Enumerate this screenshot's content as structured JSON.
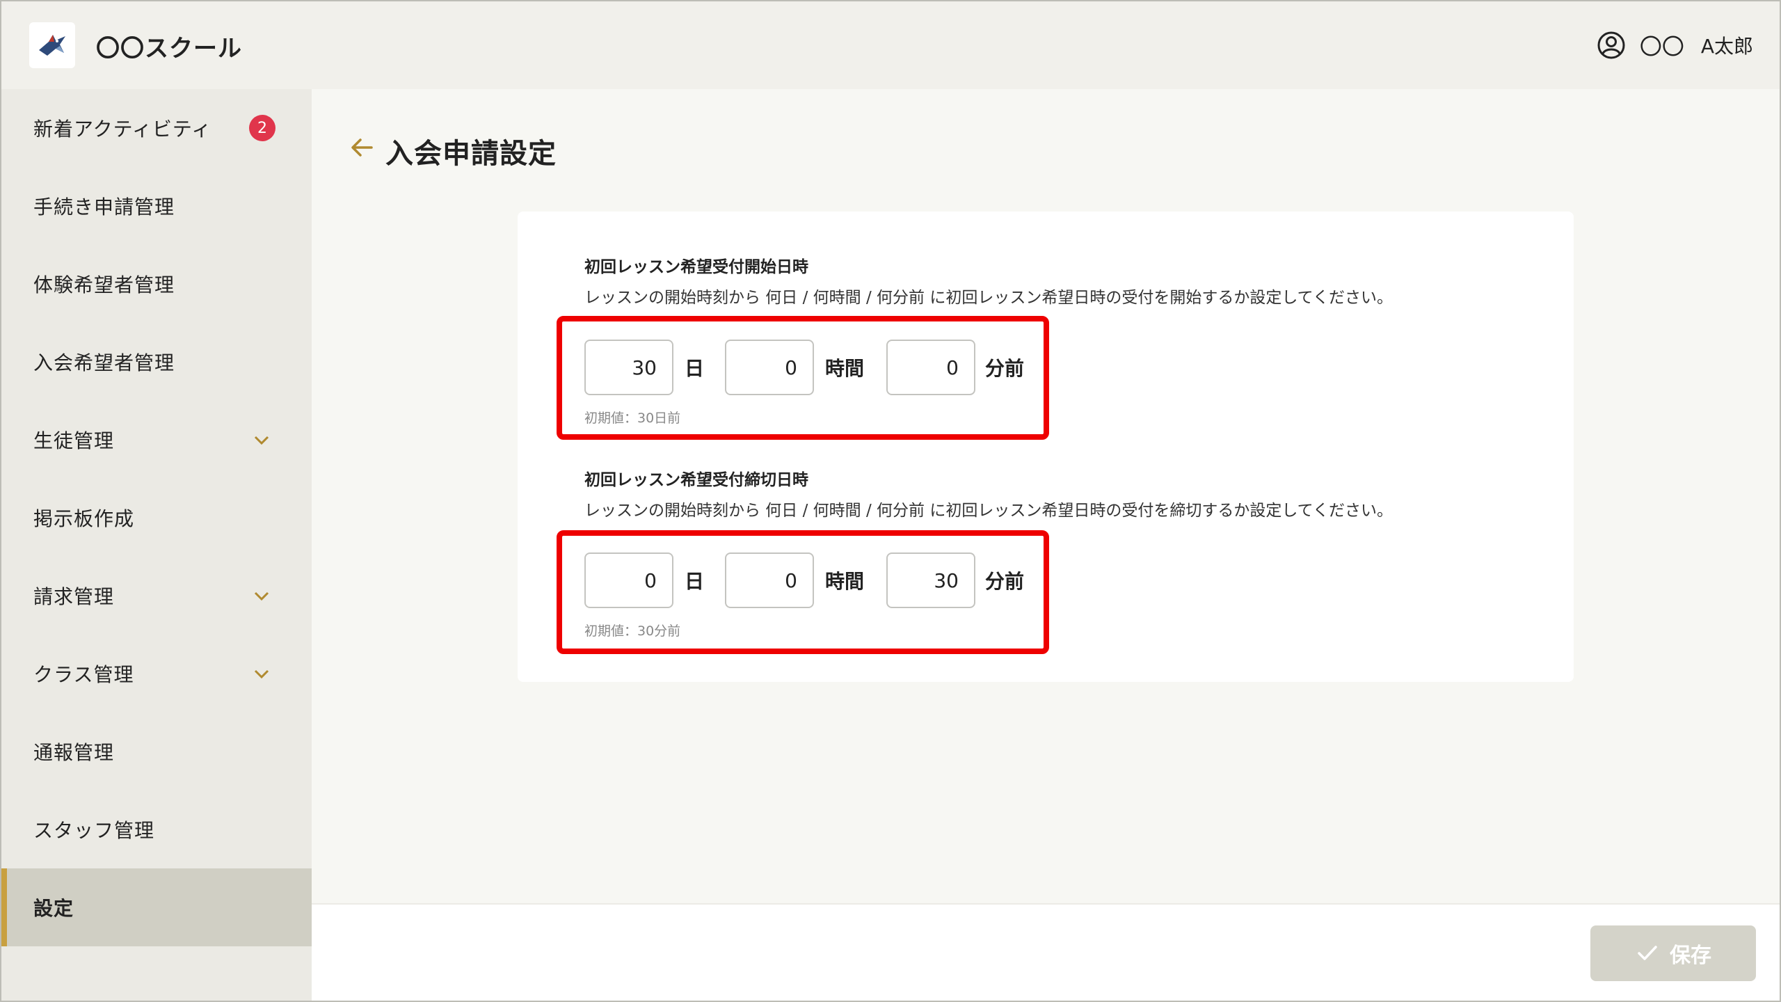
{
  "header": {
    "logo_icon": "bird-logo-icon",
    "school_name": "〇〇スクール",
    "user_icon": "user-circle-icon",
    "user_family": "〇〇",
    "user_given": "A太郎"
  },
  "sidebar": {
    "items": [
      {
        "label": "新着アクティビティ",
        "badge": "2"
      },
      {
        "label": "手続き申請管理"
      },
      {
        "label": "体験希望者管理"
      },
      {
        "label": "入会希望者管理"
      },
      {
        "label": "生徒管理",
        "expandable": true
      },
      {
        "label": "掲示板作成"
      },
      {
        "label": "請求管理",
        "expandable": true
      },
      {
        "label": "クラス管理",
        "expandable": true
      },
      {
        "label": "通報管理"
      },
      {
        "label": "スタッフ管理"
      },
      {
        "label": "設定",
        "active": true
      }
    ]
  },
  "page": {
    "title": "入会申請設定"
  },
  "sections": [
    {
      "title": "初回レッスン希望受付開始日時",
      "description": "レッスンの開始時刻から 何日 / 何時間 / 何分前 に初回レッスン希望日時の受付を開始するか設定してください。",
      "days": "30",
      "hours": "0",
      "minutes": "0",
      "unit_day": "日",
      "unit_hour": "時間",
      "unit_min": "分前",
      "hint": "初期値：30日前"
    },
    {
      "title": "初回レッスン希望受付締切日時",
      "description": "レッスンの開始時刻から 何日 / 何時間 / 何分前 に初回レッスン希望日時の受付を締切するか設定してください。",
      "days": "0",
      "hours": "0",
      "minutes": "30",
      "unit_day": "日",
      "unit_hour": "時間",
      "unit_min": "分前",
      "hint": "初期値：30分前"
    }
  ],
  "footer": {
    "save_label": "保存",
    "save_icon": "check-icon"
  },
  "colors": {
    "accent": "#c8a040",
    "badge": "#e0354b",
    "highlight": "#ee0000",
    "button_disabled": "#d4d3c9"
  }
}
